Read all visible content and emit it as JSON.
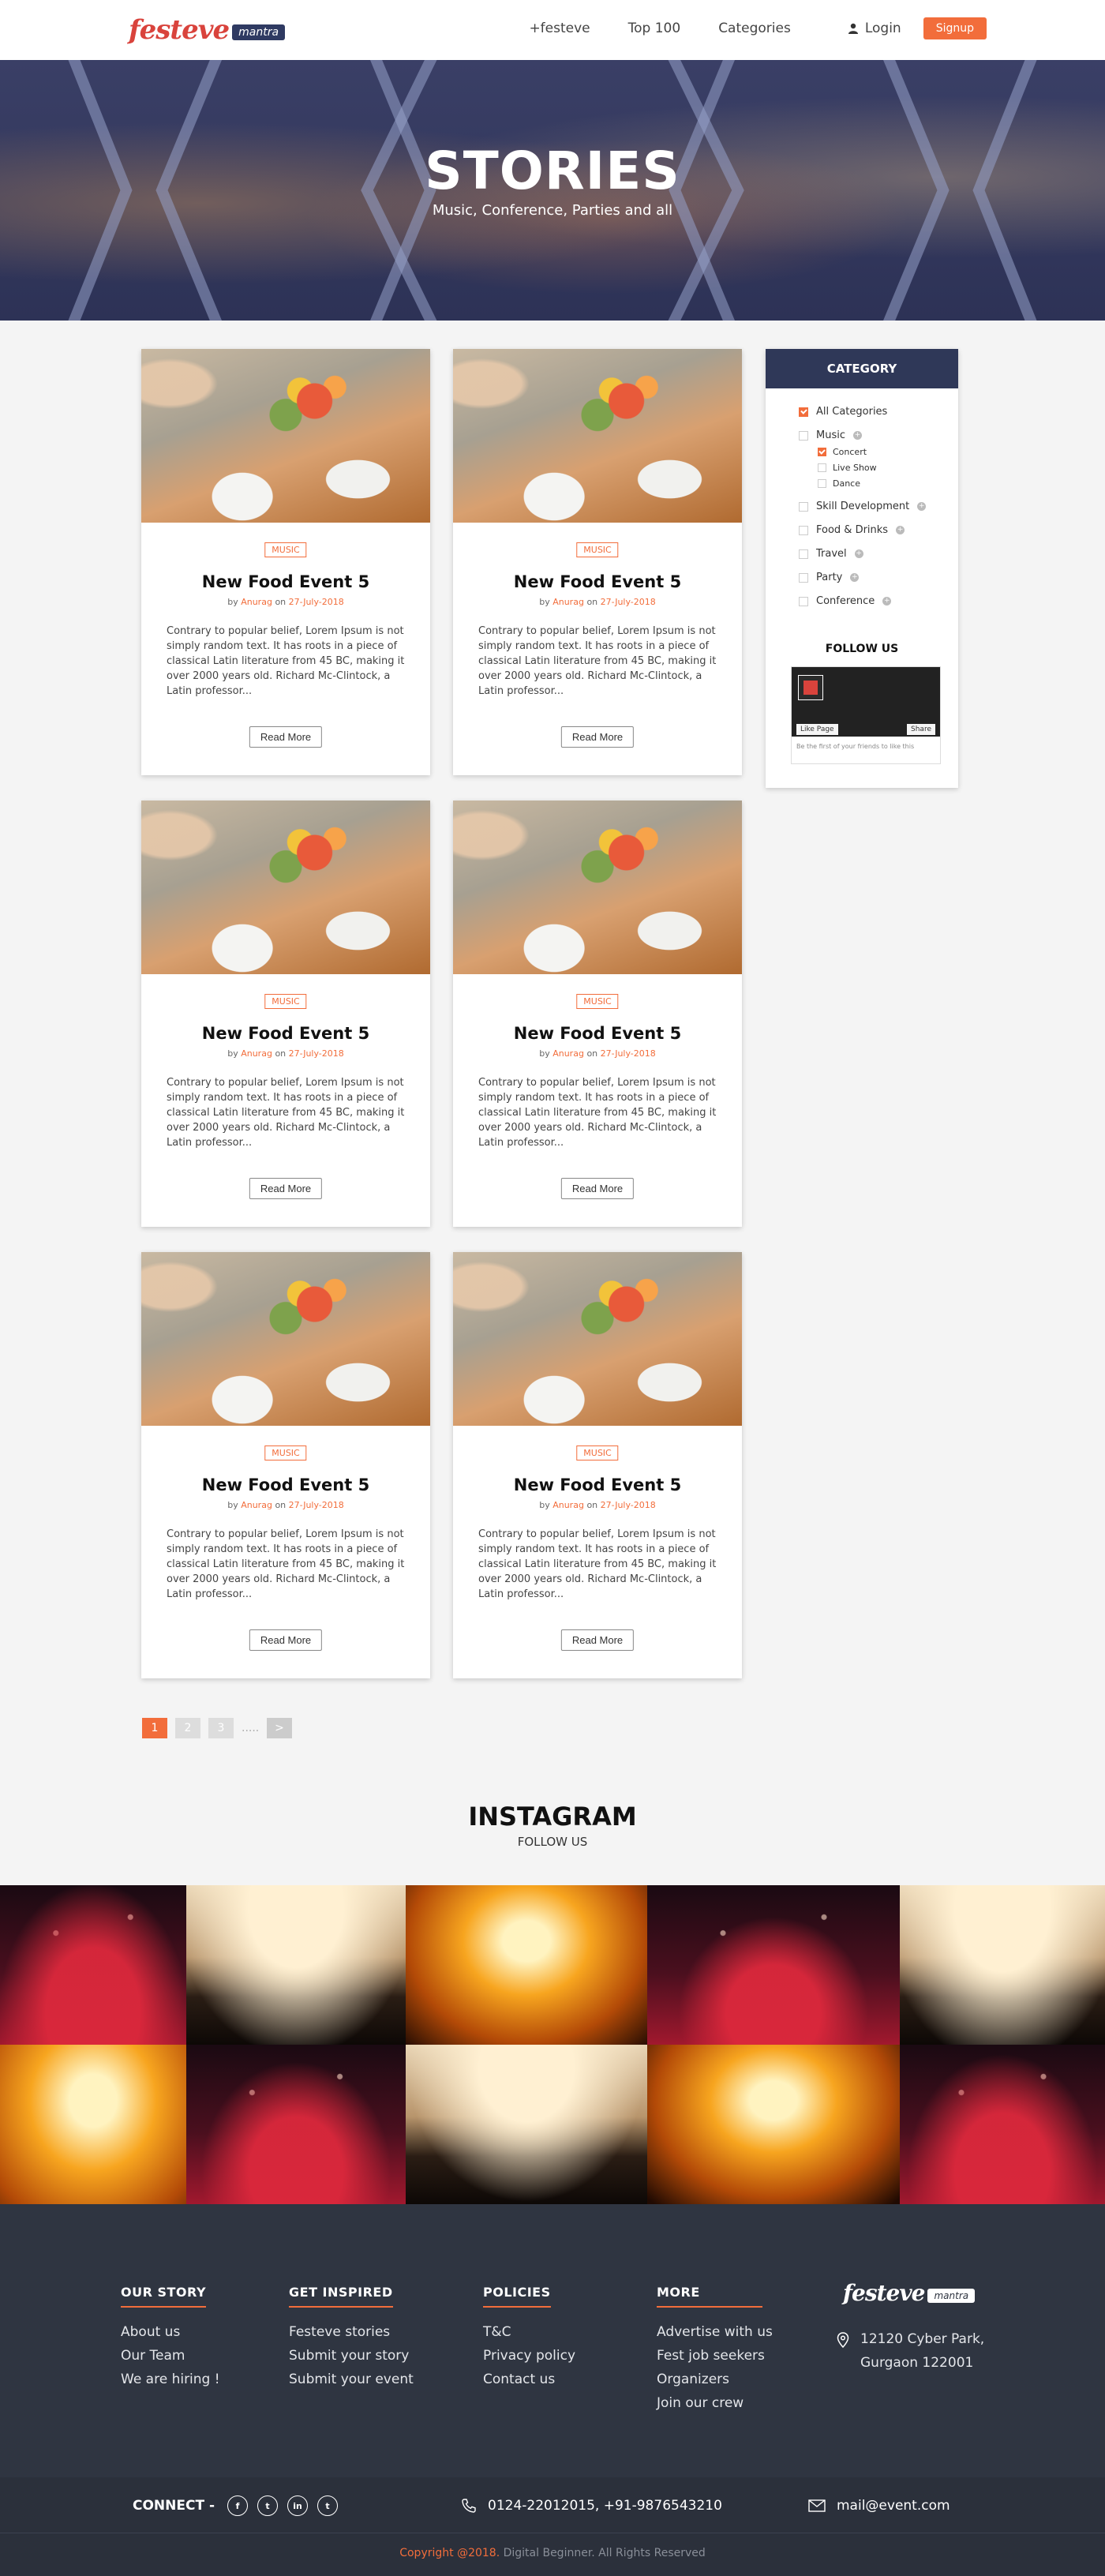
{
  "header": {
    "logo_text": "festeve",
    "logo_badge": "mantra",
    "nav": [
      "+festeve",
      "Top 100",
      "Categories"
    ],
    "login_label": "Login",
    "signup_label": "Signup"
  },
  "hero": {
    "title": "STORIES",
    "subtitle": "Music, Conference, Parties and all"
  },
  "cards": [
    {
      "tag": "MUSIC",
      "title": "New Food Event 5",
      "by": "by",
      "author": "Anurag",
      "on": "on",
      "date": "27-July-2018",
      "excerpt": "Contrary to popular belief, Lorem Ipsum is not simply random text. It has roots in a piece of classical Latin literature from 45 BC, making it over 2000 years old. Richard Mc-Clintock, a Latin professor...",
      "button": "Read More"
    },
    {
      "tag": "MUSIC",
      "title": "New Food Event 5",
      "by": "by",
      "author": "Anurag",
      "on": "on",
      "date": "27-July-2018",
      "excerpt": "Contrary to popular belief, Lorem Ipsum is not simply random text. It has roots in a piece of classical Latin literature from 45 BC, making it over 2000 years old. Richard Mc-Clintock, a Latin professor...",
      "button": "Read More"
    },
    {
      "tag": "MUSIC",
      "title": "New Food Event 5",
      "by": "by",
      "author": "Anurag",
      "on": "on",
      "date": "27-July-2018",
      "excerpt": "Contrary to popular belief, Lorem Ipsum is not simply random text. It has roots in a piece of classical Latin literature from 45 BC, making it over 2000 years old. Richard Mc-Clintock, a Latin professor...",
      "button": "Read More"
    },
    {
      "tag": "MUSIC",
      "title": "New Food Event 5",
      "by": "by",
      "author": "Anurag",
      "on": "on",
      "date": "27-July-2018",
      "excerpt": "Contrary to popular belief, Lorem Ipsum is not simply random text. It has roots in a piece of classical Latin literature from 45 BC, making it over 2000 years old. Richard Mc-Clintock, a Latin professor...",
      "button": "Read More"
    },
    {
      "tag": "MUSIC",
      "title": "New Food Event 5",
      "by": "by",
      "author": "Anurag",
      "on": "on",
      "date": "27-July-2018",
      "excerpt": "Contrary to popular belief, Lorem Ipsum is not simply random text. It has roots in a piece of classical Latin literature from 45 BC, making it over 2000 years old. Richard Mc-Clintock, a Latin professor...",
      "button": "Read More"
    },
    {
      "tag": "MUSIC",
      "title": "New Food Event 5",
      "by": "by",
      "author": "Anurag",
      "on": "on",
      "date": "27-July-2018",
      "excerpt": "Contrary to popular belief, Lorem Ipsum is not simply random text. It has roots in a piece of classical Latin literature from 45 BC, making it over 2000 years old. Richard Mc-Clintock, a Latin professor...",
      "button": "Read More"
    }
  ],
  "sidebar": {
    "heading": "CATEGORY",
    "categories": [
      {
        "label": "All Categories",
        "checked": true
      },
      {
        "label": "Music",
        "checked": false,
        "expand": "+"
      },
      {
        "label": "Concert",
        "checked": true,
        "sub": true
      },
      {
        "label": "Live Show",
        "checked": false,
        "sub": true
      },
      {
        "label": "Dance",
        "checked": false,
        "sub": true
      },
      {
        "label": "Skill Development",
        "checked": false,
        "expand": "+"
      },
      {
        "label": "Food & Drinks",
        "checked": false,
        "expand": "+"
      },
      {
        "label": "Travel",
        "checked": false,
        "expand": "+"
      },
      {
        "label": "Party",
        "checked": false,
        "expand": "+"
      },
      {
        "label": "Conference",
        "checked": false,
        "expand": "+"
      }
    ],
    "follow_heading": "FOLLOW US",
    "fb_like": "Like Page",
    "fb_share": "Share",
    "fb_footer": "Be the first of your friends to like this"
  },
  "pagination": {
    "pages": [
      "1",
      "2",
      "3"
    ],
    "dots": ".....",
    "next": ">"
  },
  "instagram": {
    "title": "INSTAGRAM",
    "subtitle": "FOLLOW US"
  },
  "footer": {
    "columns": [
      {
        "heading": "OUR STORY",
        "links": [
          "About us",
          "Our Team",
          "We are hiring !"
        ]
      },
      {
        "heading": "GET INSPIRED",
        "links": [
          "Festeve stories",
          "Submit your story",
          "Submit your event"
        ]
      },
      {
        "heading": "POLICIES",
        "links": [
          "T&C",
          "Privacy policy",
          "Contact us"
        ]
      },
      {
        "heading": "MORE",
        "links": [
          "Advertise with us",
          "Fest job seekers",
          "Organizers",
          "Join our crew"
        ]
      }
    ],
    "logo_text": "festeve",
    "logo_badge": "mantra",
    "address_line1": "12120 Cyber Park,",
    "address_line2": "Gurgaon 122001"
  },
  "bottom": {
    "connect_label": "CONNECT -",
    "social": [
      "f",
      "t",
      "in",
      "t"
    ],
    "phone": "0124-22012015, +91-9876543210",
    "email": "mail@event.com",
    "copyright_hl": "Copyright @2018.",
    "copyright_rest": " Digital Beginner. All Rights Reserved"
  },
  "colors": {
    "accent": "#f26d3b",
    "navy": "#2f3858",
    "footer": "#2f3541"
  }
}
